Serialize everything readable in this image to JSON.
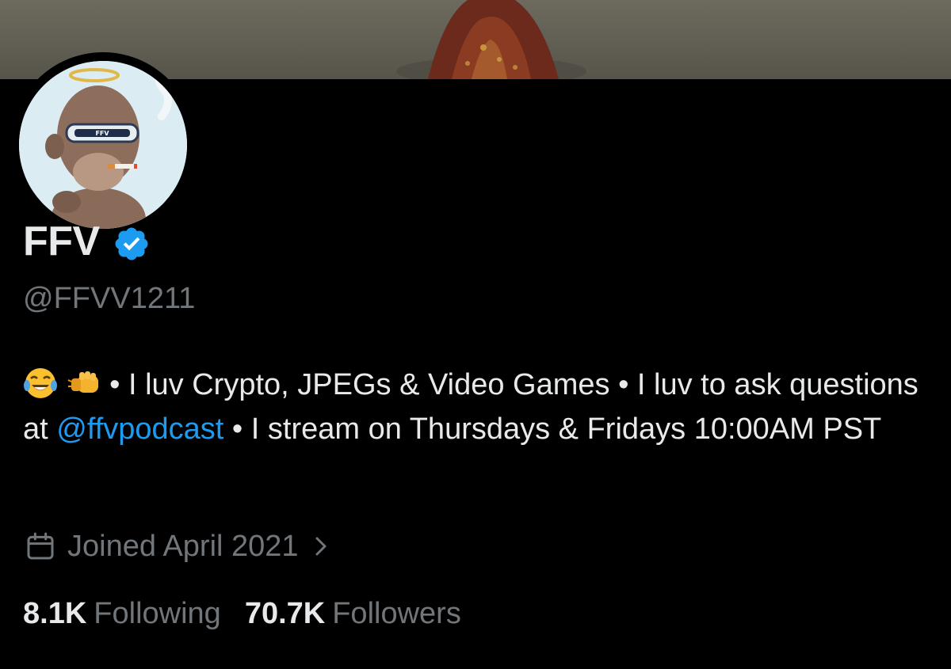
{
  "profile": {
    "display_name": "FFV",
    "handle": "@FFVV1211",
    "verified": true,
    "bio": {
      "emoji_1": "laughing-tears-emoji",
      "emoji_2": "fist-bump-emoji",
      "text_part_1": " • I luv Crypto, JPEGs & Video Games • I luv to ask questions at ",
      "mention": "@ffvpodcast",
      "text_part_2": " • I stream on Thursdays & Fridays 10:00AM PST"
    },
    "joined": "Joined April 2021",
    "following_count": "8.1K",
    "following_label": "Following",
    "followers_count": "70.7K",
    "followers_label": "Followers"
  },
  "colors": {
    "background": "#000000",
    "primary_text": "#e7e9ea",
    "secondary_text": "#71767b",
    "accent": "#1d9bf0"
  },
  "icons": {
    "verified": "verified-badge-icon",
    "calendar": "calendar-icon",
    "chevron": "chevron-right-icon"
  }
}
